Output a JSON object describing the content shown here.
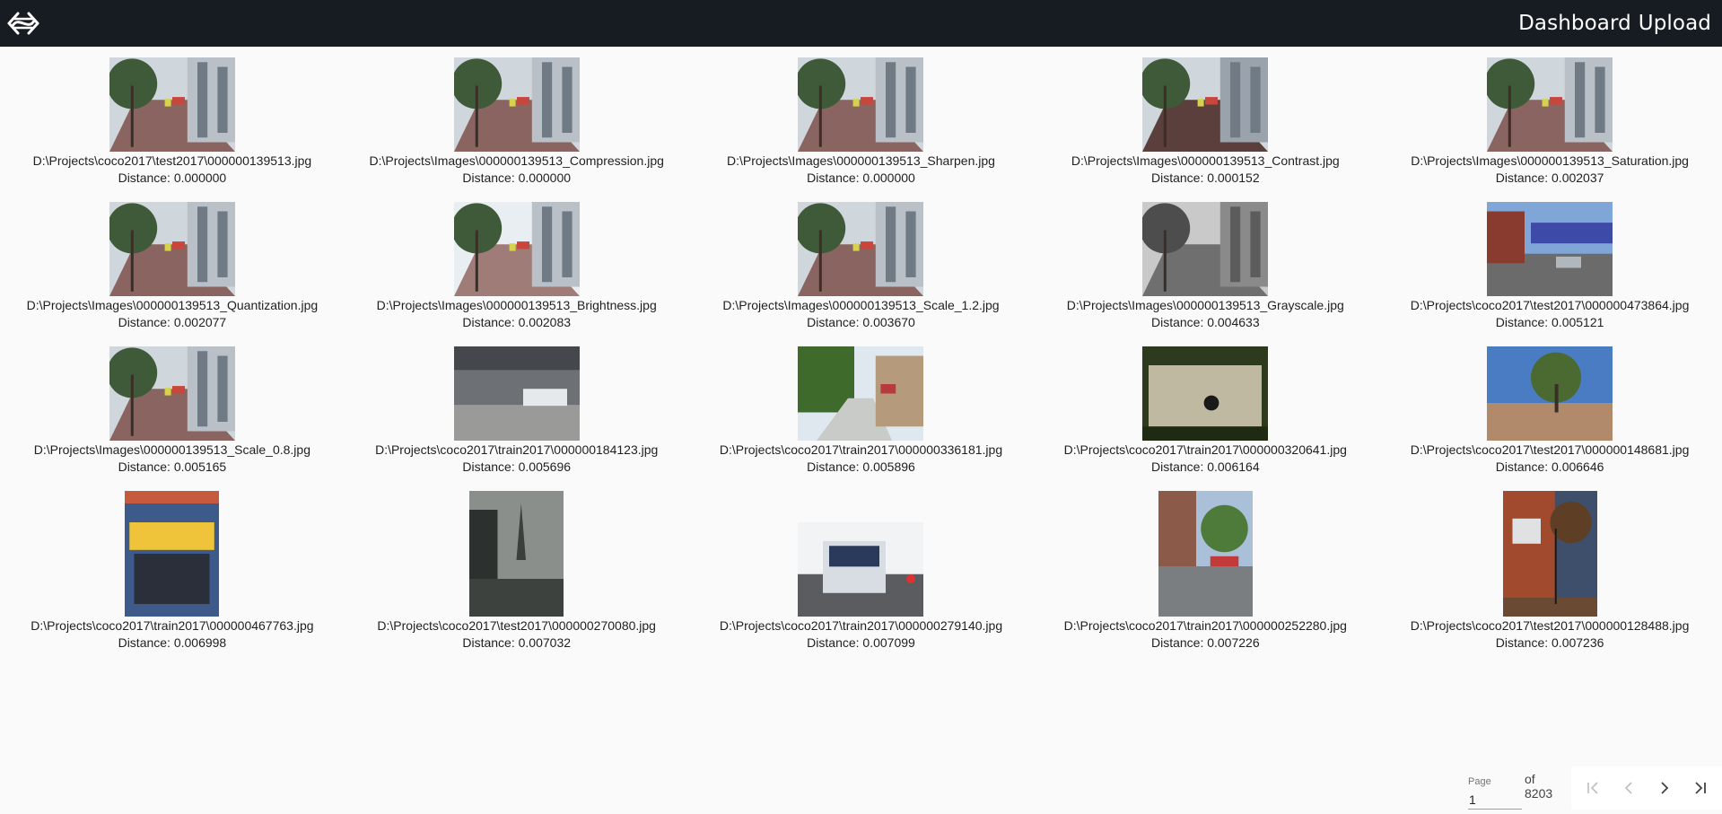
{
  "header": {
    "logo_icon": "linked-arrows-logo-icon",
    "nav": [
      "Dashboard",
      "Upload"
    ]
  },
  "results": [
    {
      "path": "D:\\Projects\\coco2017\\test2017\\000000139513.jpg",
      "distance": "Distance: 0.000000",
      "scene": "street"
    },
    {
      "path": "D:\\Projects\\Images\\000000139513_Compression.jpg",
      "distance": "Distance: 0.000000",
      "scene": "street"
    },
    {
      "path": "D:\\Projects\\Images\\000000139513_Sharpen.jpg",
      "distance": "Distance: 0.000000",
      "scene": "street"
    },
    {
      "path": "D:\\Projects\\Images\\000000139513_Contrast.jpg",
      "distance": "Distance: 0.000152",
      "scene": "street-dark"
    },
    {
      "path": "D:\\Projects\\Images\\000000139513_Saturation.jpg",
      "distance": "Distance: 0.002037",
      "scene": "street"
    },
    {
      "path": "D:\\Projects\\Images\\000000139513_Quantization.jpg",
      "distance": "Distance: 0.002077",
      "scene": "street"
    },
    {
      "path": "D:\\Projects\\Images\\000000139513_Brightness.jpg",
      "distance": "Distance: 0.002083",
      "scene": "street-bright"
    },
    {
      "path": "D:\\Projects\\Images\\000000139513_Scale_1.2.jpg",
      "distance": "Distance: 0.003670",
      "scene": "street"
    },
    {
      "path": "D:\\Projects\\Images\\000000139513_Grayscale.jpg",
      "distance": "Distance: 0.004633",
      "scene": "street-gray"
    },
    {
      "path": "D:\\Projects\\coco2017\\test2017\\000000473864.jpg",
      "distance": "Distance: 0.005121",
      "scene": "bridge"
    },
    {
      "path": "D:\\Projects\\Images\\000000139513_Scale_0.8.jpg",
      "distance": "Distance: 0.005165",
      "scene": "street"
    },
    {
      "path": "D:\\Projects\\coco2017\\train2017\\000000184123.jpg",
      "distance": "Distance: 0.005696",
      "scene": "station"
    },
    {
      "path": "D:\\Projects\\coco2017\\train2017\\000000336181.jpg",
      "distance": "Distance: 0.005896",
      "scene": "green-street"
    },
    {
      "path": "D:\\Projects\\coco2017\\train2017\\000000320641.jpg",
      "distance": "Distance: 0.006164",
      "scene": "lake-cyclist"
    },
    {
      "path": "D:\\Projects\\coco2017\\test2017\\000000148681.jpg",
      "distance": "Distance: 0.006646",
      "scene": "tree-sky"
    },
    {
      "path": "D:\\Projects\\coco2017\\train2017\\000000467763.jpg",
      "distance": "Distance: 0.006998",
      "scene": "shop"
    },
    {
      "path": "D:\\Projects\\coco2017\\test2017\\000000270080.jpg",
      "distance": "Distance: 0.007032",
      "scene": "spire"
    },
    {
      "path": "D:\\Projects\\coco2017\\train2017\\000000279140.jpg",
      "distance": "Distance: 0.007099",
      "scene": "bus"
    },
    {
      "path": "D:\\Projects\\coco2017\\train2017\\000000252280.jpg",
      "distance": "Distance: 0.007226",
      "scene": "plaza"
    },
    {
      "path": "D:\\Projects\\coco2017\\test2017\\000000128488.jpg",
      "distance": "Distance: 0.007236",
      "scene": "brick"
    }
  ],
  "pagination": {
    "label": "Page",
    "current": "1",
    "of_text": "of 8203",
    "buttons": [
      "first-page-icon",
      "previous-page-icon",
      "next-page-icon",
      "last-page-icon"
    ]
  }
}
